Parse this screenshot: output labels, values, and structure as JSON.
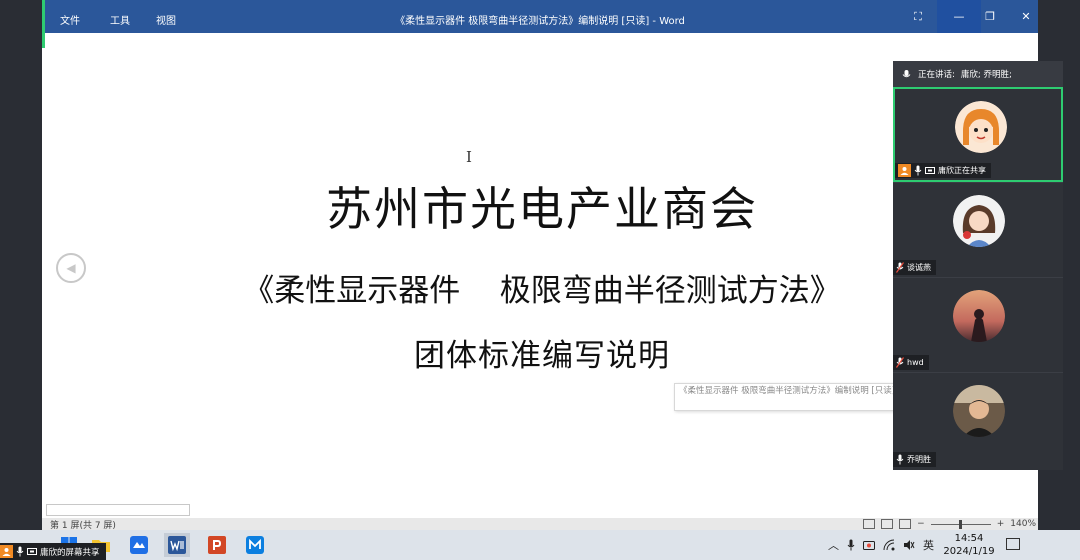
{
  "word": {
    "menu": [
      "文件",
      "工具",
      "视图"
    ],
    "window_title": "《柔性显示器件 极限弯曲半径测试方法》编制说明 [只读] - Word",
    "controls": {
      "fullscreen": "⛶",
      "minimize": "—",
      "restore": "❐",
      "close": "✕"
    }
  },
  "document": {
    "title": "苏州市光电产业商会",
    "subtitle": "《柔性显示器件    极限弯曲半径测试方法》",
    "heading": "团体标准编写说明",
    "cursor": "I",
    "prev_arrow": "◀",
    "tooltip": "《柔性显示器件 极限弯曲半径测试方法》编制说明 [只读] - Word"
  },
  "statusbar": {
    "page": "第 1 屏(共 7 屏)",
    "zoom_minus": "−",
    "zoom_plus": "+",
    "zoom": "140%"
  },
  "meeting": {
    "speaking_label": "正在讲话:",
    "speaking_names": "庸欣; 乔明胜;",
    "participants": [
      {
        "name": "庸欣正在共享",
        "active": true
      },
      {
        "name": "谈诚燕"
      },
      {
        "name": "hwd"
      },
      {
        "name": "乔明胜"
      }
    ],
    "share_badge": "庸欣的屏幕共享"
  },
  "taskbar": {
    "tray_chevron": "︿",
    "ime": "英",
    "time": "14:54",
    "date": "2024/1/19"
  },
  "colors": {
    "word_blue": "#2b579a",
    "share_green": "#2ecc71",
    "panel_bg": "#2f3238",
    "taskbar_bg": "#dde3ea"
  }
}
